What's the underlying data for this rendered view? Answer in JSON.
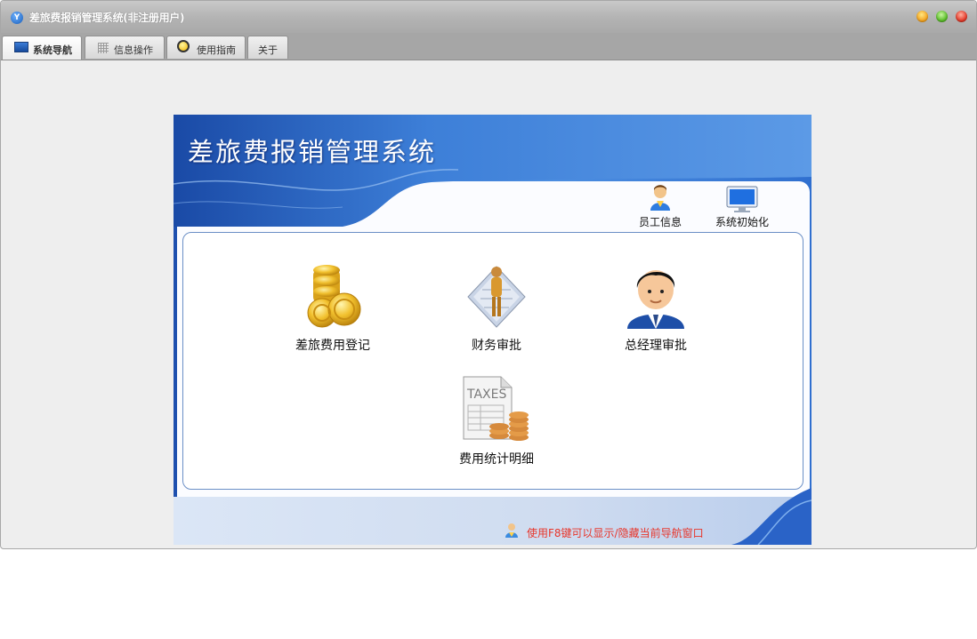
{
  "window": {
    "title": "差旅费报销管理系统(非注册用户)",
    "icon": "app-logo-icon"
  },
  "tabs": [
    {
      "label": "系统导航",
      "icon": "monitor-icon",
      "active": true
    },
    {
      "label": "信息操作",
      "icon": "grid-icon",
      "active": false
    },
    {
      "label": "使用指南",
      "icon": "help-icon",
      "active": false
    },
    {
      "label": "关于",
      "icon": "",
      "active": false
    }
  ],
  "panel": {
    "title": "差旅费报销管理系统",
    "top_actions": [
      {
        "label": "员工信息",
        "icon": "employee-icon"
      },
      {
        "label": "系统初始化",
        "icon": "monitor-icon"
      }
    ],
    "modules": [
      {
        "label": "差旅费用登记",
        "icon": "gold-coins-icon"
      },
      {
        "label": "财务审批",
        "icon": "finance-approval-icon"
      },
      {
        "label": "总经理审批",
        "icon": "manager-avatar-icon"
      },
      {
        "label": "费用统计明细",
        "icon": "taxes-report-icon"
      }
    ],
    "taxes_text": "TAXES",
    "hint": "使用F8键可以显示/隐藏当前导航窗口"
  },
  "colors": {
    "title_bar": "#b4b4b4",
    "tab_bar": "#a6a6a6",
    "panel_blue": "#3a7ad5",
    "hint_red": "#e8352a"
  }
}
